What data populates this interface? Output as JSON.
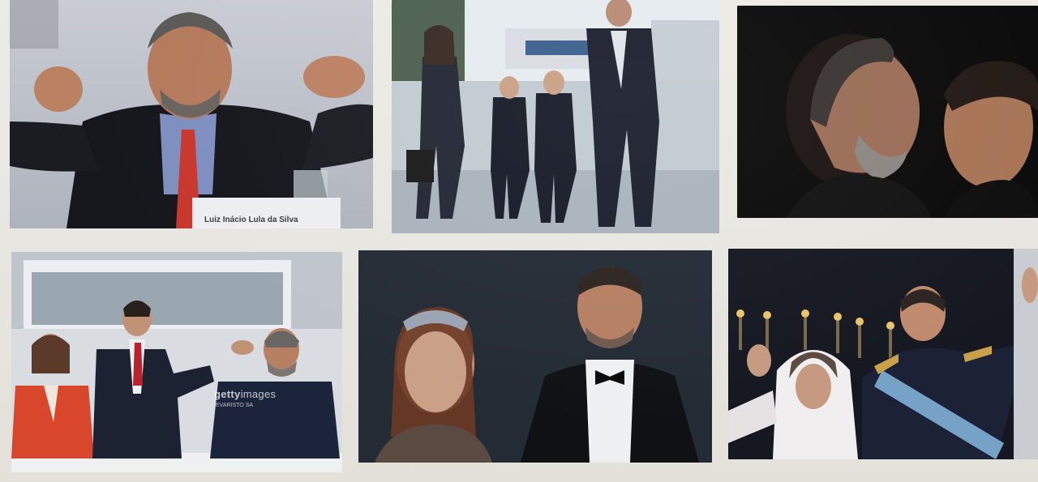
{
  "images": [
    {
      "id": "img-1",
      "caption": "Luiz Inácio Lula da Silva"
    },
    {
      "id": "img-2"
    },
    {
      "id": "img-3"
    },
    {
      "id": "img-4",
      "watermark_brand": "getty",
      "watermark_brand_suffix": "images",
      "watermark_credit": "EVARISTO SA"
    },
    {
      "id": "img-5"
    },
    {
      "id": "img-6"
    }
  ],
  "colors": {
    "screen": "#e9e6df",
    "accent_red": "#c8372d",
    "navy": "#1c2436"
  }
}
